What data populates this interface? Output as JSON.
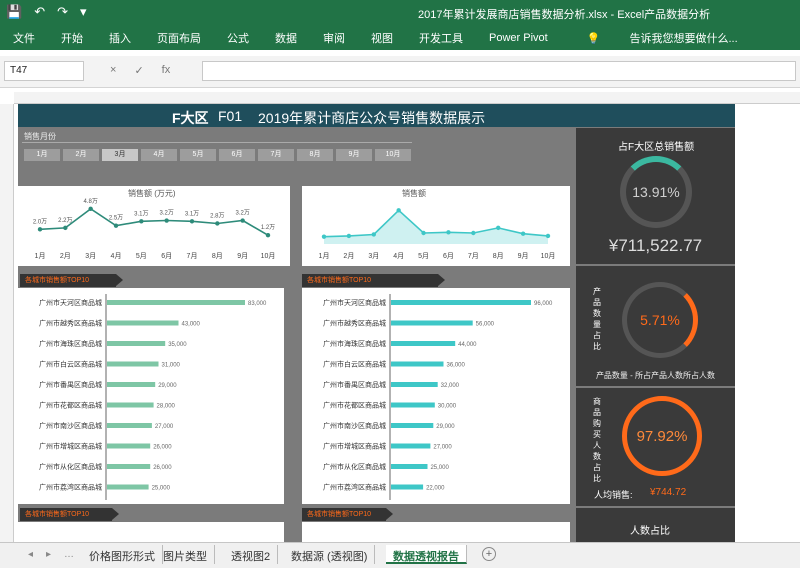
{
  "window": {
    "title": "2017年累计发展商店销售数据分析.xlsx - Excel产品数据分析"
  },
  "ribbon": {
    "tabs": [
      "文件",
      "开始",
      "插入",
      "页面布局",
      "公式",
      "数据",
      "审阅",
      "视图",
      "开发工具",
      "Power Pivot",
      "告诉我您想要做什么..."
    ]
  },
  "formula_bar": {
    "name_box": "T47",
    "cancel": "×",
    "enter": "✓",
    "fx": "fx"
  },
  "dashboard": {
    "brand": "F大区",
    "code": "F01",
    "title": "2019年累计商店公众号销售数据展示",
    "slicer_label": "销售月份",
    "slicer_months": [
      "1月",
      "2月",
      "3月",
      "4月",
      "5月",
      "6月",
      "7月",
      "8月",
      "9月",
      "10月"
    ],
    "slicer_selected_index": 2,
    "chart1_legend": "销售额 (万元)",
    "chart2_legend": "销售额",
    "x_labels": [
      "1月",
      "2月",
      "3月",
      "4月",
      "5月",
      "6月",
      "7月",
      "8月",
      "9月",
      "10月"
    ],
    "chart1_point_labels": [
      "2.0万",
      "2.2万",
      "4.8万",
      "2.5万",
      "3.1万",
      "3.2万",
      "3.1万",
      "2.8万",
      "3.2万",
      "1.2万"
    ],
    "panel1_title": "各城市销售额TOP10",
    "panel2_title": "各城市销售额TOP10",
    "panel3_title": "各城市销售额TOP10",
    "panel4_title": "各城市销售额TOP10",
    "kpi1": {
      "title": "占F大区总销售额",
      "percent": "13.91%",
      "amount": "¥711,522.77"
    },
    "kpi2": {
      "side_label": "产品数量占比",
      "percent": "5.71%",
      "footer": "产品数量 - 所占产品人数所占人数"
    },
    "kpi3": {
      "side_label": "商品购买人数占比",
      "percent": "97.92%",
      "footer_label": "人均销售:",
      "footer_value": "¥744.72"
    },
    "kpi4": {
      "title": "人数占比"
    }
  },
  "chart_data": [
    {
      "type": "line",
      "x": [
        "1月",
        "2月",
        "3月",
        "4月",
        "5月",
        "6月",
        "7月",
        "8月",
        "9月",
        "10月"
      ],
      "series": [
        {
          "name": "销售额 (万元)",
          "values": [
            2.0,
            2.2,
            4.8,
            2.5,
            3.1,
            3.2,
            3.1,
            2.8,
            3.2,
            1.2
          ]
        }
      ],
      "ylim": [
        0,
        6
      ],
      "grid": false
    },
    {
      "type": "line",
      "x": [
        "1月",
        "2月",
        "3月",
        "4月",
        "5月",
        "6月",
        "7月",
        "8月",
        "9月",
        "10月"
      ],
      "series": [
        {
          "name": "销售额",
          "values": [
            1.0,
            1.1,
            1.3,
            4.6,
            1.5,
            1.6,
            1.5,
            2.2,
            1.4,
            1.1
          ]
        }
      ],
      "ylim": [
        0,
        6
      ],
      "grid": false
    },
    {
      "type": "bar",
      "categories": [
        "广州市天河区商品城",
        "广州市越秀区商品城",
        "广州市海珠区商品城",
        "广州市白云区商品城",
        "广州市番禺区商品城",
        "广州市花都区商品城",
        "广州市南沙区商品城",
        "广州市增城区商品城",
        "广州市从化区商品城",
        "广州市荔湾区商品城"
      ],
      "values": [
        83000,
        43000,
        35000,
        31000,
        29000,
        28000,
        27000,
        26000,
        26000,
        25000
      ]
    },
    {
      "type": "bar",
      "categories": [
        "广州市天河区商品城",
        "广州市越秀区商品城",
        "广州市海珠区商品城",
        "广州市白云区商品城",
        "广州市番禺区商品城",
        "广州市花都区商品城",
        "广州市南沙区商品城",
        "广州市增城区商品城",
        "广州市从化区商品城",
        "广州市荔湾区商品城"
      ],
      "values": [
        96000,
        56000,
        44000,
        36000,
        32000,
        30000,
        29000,
        27000,
        25000,
        22000
      ]
    }
  ],
  "sheet_tabs": [
    "价格图形形式",
    "图片类型",
    "透视图2",
    "数据源 (透视图)",
    "数据透视报告"
  ],
  "active_tab": 4,
  "colors": {
    "excel_green": "#217346",
    "bar_green": "#7ec6a5",
    "bar_teal": "#3ec7c7",
    "kpi_orange": "#ff6a1a",
    "kpi_teal": "#3bb8a0"
  }
}
